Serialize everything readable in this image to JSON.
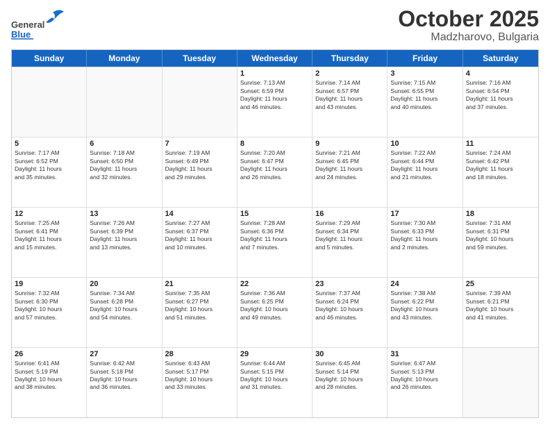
{
  "header": {
    "logo_general": "General",
    "logo_blue": "Blue",
    "title": "October 2025",
    "subtitle": "Madzharovo, Bulgaria"
  },
  "days_of_week": [
    "Sunday",
    "Monday",
    "Tuesday",
    "Wednesday",
    "Thursday",
    "Friday",
    "Saturday"
  ],
  "weeks": [
    [
      {
        "day": "",
        "info": ""
      },
      {
        "day": "",
        "info": ""
      },
      {
        "day": "",
        "info": ""
      },
      {
        "day": "1",
        "info": "Sunrise: 7:13 AM\nSunset: 6:59 PM\nDaylight: 11 hours\nand 46 minutes."
      },
      {
        "day": "2",
        "info": "Sunrise: 7:14 AM\nSunset: 6:57 PM\nDaylight: 11 hours\nand 43 minutes."
      },
      {
        "day": "3",
        "info": "Sunrise: 7:15 AM\nSunset: 6:55 PM\nDaylight: 11 hours\nand 40 minutes."
      },
      {
        "day": "4",
        "info": "Sunrise: 7:16 AM\nSunset: 6:54 PM\nDaylight: 11 hours\nand 37 minutes."
      }
    ],
    [
      {
        "day": "5",
        "info": "Sunrise: 7:17 AM\nSunset: 6:52 PM\nDaylight: 11 hours\nand 35 minutes."
      },
      {
        "day": "6",
        "info": "Sunrise: 7:18 AM\nSunset: 6:50 PM\nDaylight: 11 hours\nand 32 minutes."
      },
      {
        "day": "7",
        "info": "Sunrise: 7:19 AM\nSunset: 6:49 PM\nDaylight: 11 hours\nand 29 minutes."
      },
      {
        "day": "8",
        "info": "Sunrise: 7:20 AM\nSunset: 6:47 PM\nDaylight: 11 hours\nand 26 minutes."
      },
      {
        "day": "9",
        "info": "Sunrise: 7:21 AM\nSunset: 6:45 PM\nDaylight: 11 hours\nand 24 minutes."
      },
      {
        "day": "10",
        "info": "Sunrise: 7:22 AM\nSunset: 6:44 PM\nDaylight: 11 hours\nand 21 minutes."
      },
      {
        "day": "11",
        "info": "Sunrise: 7:24 AM\nSunset: 6:42 PM\nDaylight: 11 hours\nand 18 minutes."
      }
    ],
    [
      {
        "day": "12",
        "info": "Sunrise: 7:25 AM\nSunset: 6:41 PM\nDaylight: 11 hours\nand 15 minutes."
      },
      {
        "day": "13",
        "info": "Sunrise: 7:26 AM\nSunset: 6:39 PM\nDaylight: 11 hours\nand 13 minutes."
      },
      {
        "day": "14",
        "info": "Sunrise: 7:27 AM\nSunset: 6:37 PM\nDaylight: 11 hours\nand 10 minutes."
      },
      {
        "day": "15",
        "info": "Sunrise: 7:28 AM\nSunset: 6:36 PM\nDaylight: 11 hours\nand 7 minutes."
      },
      {
        "day": "16",
        "info": "Sunrise: 7:29 AM\nSunset: 6:34 PM\nDaylight: 11 hours\nand 5 minutes."
      },
      {
        "day": "17",
        "info": "Sunrise: 7:30 AM\nSunset: 6:33 PM\nDaylight: 11 hours\nand 2 minutes."
      },
      {
        "day": "18",
        "info": "Sunrise: 7:31 AM\nSunset: 6:31 PM\nDaylight: 10 hours\nand 59 minutes."
      }
    ],
    [
      {
        "day": "19",
        "info": "Sunrise: 7:32 AM\nSunset: 6:30 PM\nDaylight: 10 hours\nand 57 minutes."
      },
      {
        "day": "20",
        "info": "Sunrise: 7:34 AM\nSunset: 6:28 PM\nDaylight: 10 hours\nand 54 minutes."
      },
      {
        "day": "21",
        "info": "Sunrise: 7:35 AM\nSunset: 6:27 PM\nDaylight: 10 hours\nand 51 minutes."
      },
      {
        "day": "22",
        "info": "Sunrise: 7:36 AM\nSunset: 6:25 PM\nDaylight: 10 hours\nand 49 minutes."
      },
      {
        "day": "23",
        "info": "Sunrise: 7:37 AM\nSunset: 6:24 PM\nDaylight: 10 hours\nand 46 minutes."
      },
      {
        "day": "24",
        "info": "Sunrise: 7:38 AM\nSunset: 6:22 PM\nDaylight: 10 hours\nand 43 minutes."
      },
      {
        "day": "25",
        "info": "Sunrise: 7:39 AM\nSunset: 6:21 PM\nDaylight: 10 hours\nand 41 minutes."
      }
    ],
    [
      {
        "day": "26",
        "info": "Sunrise: 6:41 AM\nSunset: 5:19 PM\nDaylight: 10 hours\nand 38 minutes."
      },
      {
        "day": "27",
        "info": "Sunrise: 6:42 AM\nSunset: 5:18 PM\nDaylight: 10 hours\nand 36 minutes."
      },
      {
        "day": "28",
        "info": "Sunrise: 6:43 AM\nSunset: 5:17 PM\nDaylight: 10 hours\nand 33 minutes."
      },
      {
        "day": "29",
        "info": "Sunrise: 6:44 AM\nSunset: 5:15 PM\nDaylight: 10 hours\nand 31 minutes."
      },
      {
        "day": "30",
        "info": "Sunrise: 6:45 AM\nSunset: 5:14 PM\nDaylight: 10 hours\nand 28 minutes."
      },
      {
        "day": "31",
        "info": "Sunrise: 6:47 AM\nSunset: 5:13 PM\nDaylight: 10 hours\nand 26 minutes."
      },
      {
        "day": "",
        "info": ""
      }
    ]
  ]
}
